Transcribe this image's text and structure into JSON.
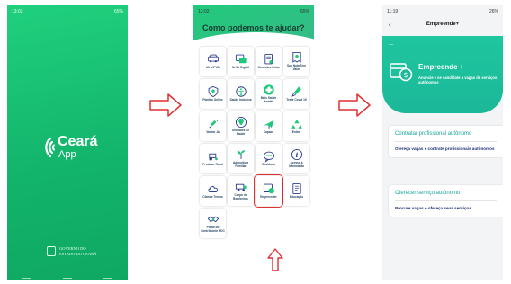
{
  "phone1": {
    "status_time": "13:02",
    "status_right": "65%",
    "logo_line1": "Ceará",
    "logo_line2": "App",
    "gov_line1": "GOVERNO DO",
    "gov_line2": "ESTADO DO CEARÁ",
    "bg_color": "#1ac574"
  },
  "phone2": {
    "status_time": "13:02",
    "status_right": "65%",
    "title": "Como podemos te ajudar?",
    "tiles": [
      {
        "label": "Meu IPVA",
        "icon": "car-icon"
      },
      {
        "label": "Selfie Digital",
        "icon": "chat-card-icon"
      },
      {
        "label": "Contrates Selas",
        "icon": "document-stamp-icon"
      },
      {
        "label": "Sua Nota Tem Valor",
        "icon": "receipt-icon"
      },
      {
        "label": "Plantão Online",
        "icon": "police-badge-icon"
      },
      {
        "label": "Saúde Inclusiva",
        "icon": "accessibility-icon"
      },
      {
        "label": "Mais Saúde Portátil",
        "icon": "health-cross-icon"
      },
      {
        "label": "Teste Covid 19",
        "icon": "test-tube-icon"
      },
      {
        "label": "Vacine Já",
        "icon": "syringe-icon"
      },
      {
        "label": "Unidades de Saúde",
        "icon": "location-pin-icon"
      },
      {
        "label": "Capace",
        "icon": "airplane-icon"
      },
      {
        "label": "Entrar",
        "icon": "recycle-icon"
      },
      {
        "label": "Produtor Rural",
        "icon": "tractor-icon"
      },
      {
        "label": "Agricultura Familiar",
        "icon": "plant-icon"
      },
      {
        "label": "Ouvidoria",
        "icon": "speech-bubble-icon"
      },
      {
        "label": "Acesso à Informação",
        "icon": "info-icon"
      },
      {
        "label": "Clima e Tempo",
        "icon": "cloud-icon"
      },
      {
        "label": "Corpo de Bombeiros",
        "icon": "fire-truck-icon"
      },
      {
        "label": "Empreender",
        "icon": "store-coin-icon"
      },
      {
        "label": "Educação",
        "icon": "book-icon"
      },
      {
        "label": "Portal do Contribuinte PDC",
        "icon": "handshake-icon"
      }
    ],
    "highlight_index": 18,
    "accent_color": "#20c97a"
  },
  "phone3": {
    "status_time": "11:19",
    "status_right": "26%",
    "appbar_title": "Empreende+",
    "hero_title": "Empreende +",
    "hero_subtitle": "Anuncie e se candidate a vagas de serviços autônomos",
    "cards": [
      {
        "title": "Contratar profissional autônomo",
        "desc": "Ofereça vagas e contrate profissionais autônomos"
      },
      {
        "title": "Oferecer serviço autônomo",
        "desc": "Procure vagas e ofereça seus serviços"
      }
    ],
    "hero_color": "#1dbf9d",
    "card_title_color": "#1aa59b"
  },
  "annotation_color": "#e03131"
}
